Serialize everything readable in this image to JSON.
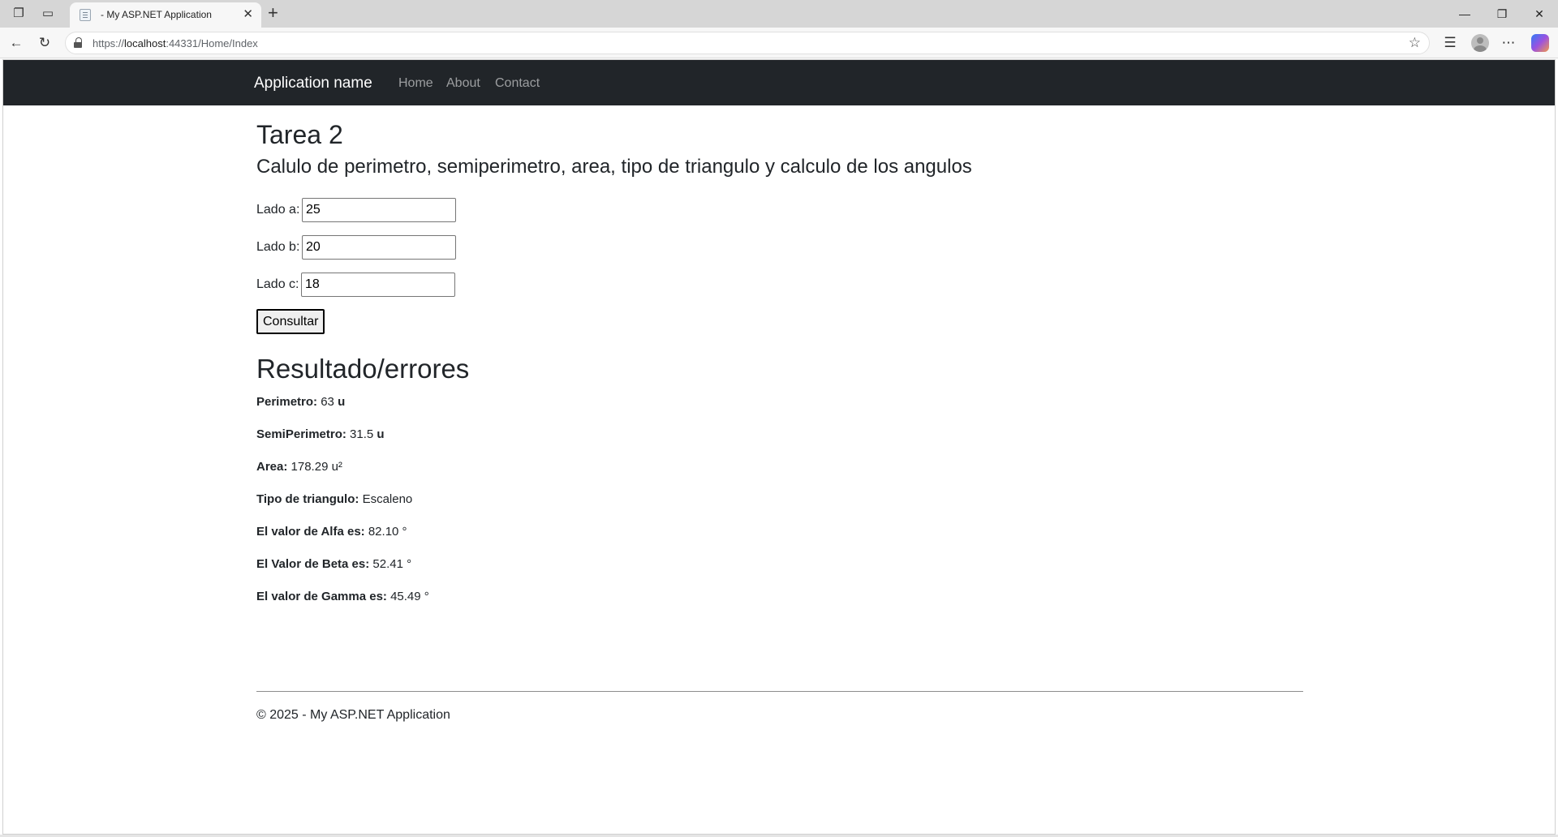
{
  "browser": {
    "tab_title": "- My ASP.NET Application",
    "url_prefix": "https://",
    "url_host": "localhost",
    "url_rest": ":44331/Home/Index"
  },
  "navbar": {
    "brand": "Application name",
    "links": [
      "Home",
      "About",
      "Contact"
    ]
  },
  "page": {
    "title": "Tarea 2",
    "subtitle": "Calulo de perimetro, semiperimetro, area, tipo de triangulo y calculo de los angulos"
  },
  "form": {
    "fields": [
      {
        "label": "Lado a:",
        "value": "25"
      },
      {
        "label": "Lado b:",
        "value": "20"
      },
      {
        "label": "Lado c:",
        "value": "18"
      }
    ],
    "submit_label": "Consultar"
  },
  "results": {
    "heading": "Resultado/errores",
    "rows": [
      {
        "label": "Perimetro:",
        "value": "63",
        "unit": "u"
      },
      {
        "label": "SemiPerimetro:",
        "value": "31.5",
        "unit": "u"
      },
      {
        "label": "Area:",
        "value": "178.29 u²",
        "unit": ""
      },
      {
        "label": "Tipo de triangulo:",
        "value": "Escaleno",
        "unit": ""
      },
      {
        "label": "El valor de Alfa es:",
        "value": "82.10 °",
        "unit": ""
      },
      {
        "label": "El Valor de Beta es:",
        "value": "52.41 °",
        "unit": ""
      },
      {
        "label": "El valor de Gamma es:",
        "value": "45.49 °",
        "unit": ""
      }
    ]
  },
  "footer": {
    "text": "© 2025 - My ASP.NET Application"
  }
}
